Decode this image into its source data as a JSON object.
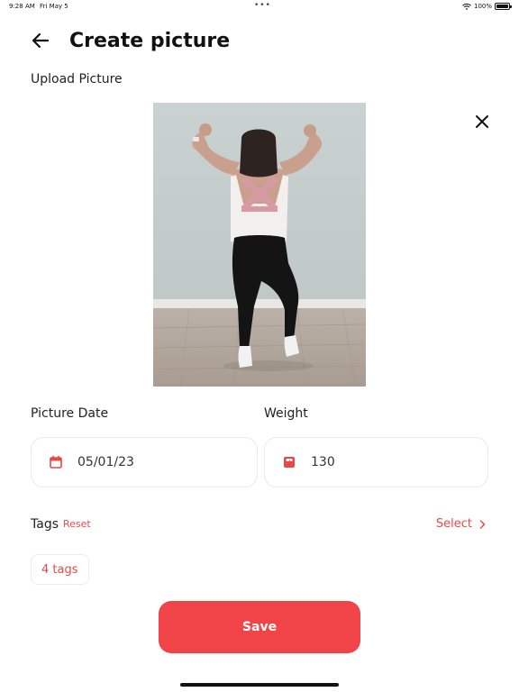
{
  "status_bar": {
    "time": "9:28 AM",
    "date": "Fri May 5",
    "dots": "•••",
    "battery": "100%"
  },
  "header": {
    "title": "Create picture",
    "back_icon": "arrow-left-icon"
  },
  "upload": {
    "label": "Upload Picture",
    "close_icon": "close-icon"
  },
  "picture_date": {
    "label": "Picture Date",
    "value": "05/01/23",
    "icon": "calendar-icon"
  },
  "weight": {
    "label": "Weight",
    "value": "130",
    "icon": "scale-icon"
  },
  "tags": {
    "label": "Tags",
    "reset_label": "Reset",
    "select_label": "Select",
    "chip_label": "4 tags"
  },
  "actions": {
    "save_label": "Save"
  },
  "colors": {
    "accent": "#f04448",
    "accent_text": "#e8484a",
    "border": "#e9e9e9"
  }
}
